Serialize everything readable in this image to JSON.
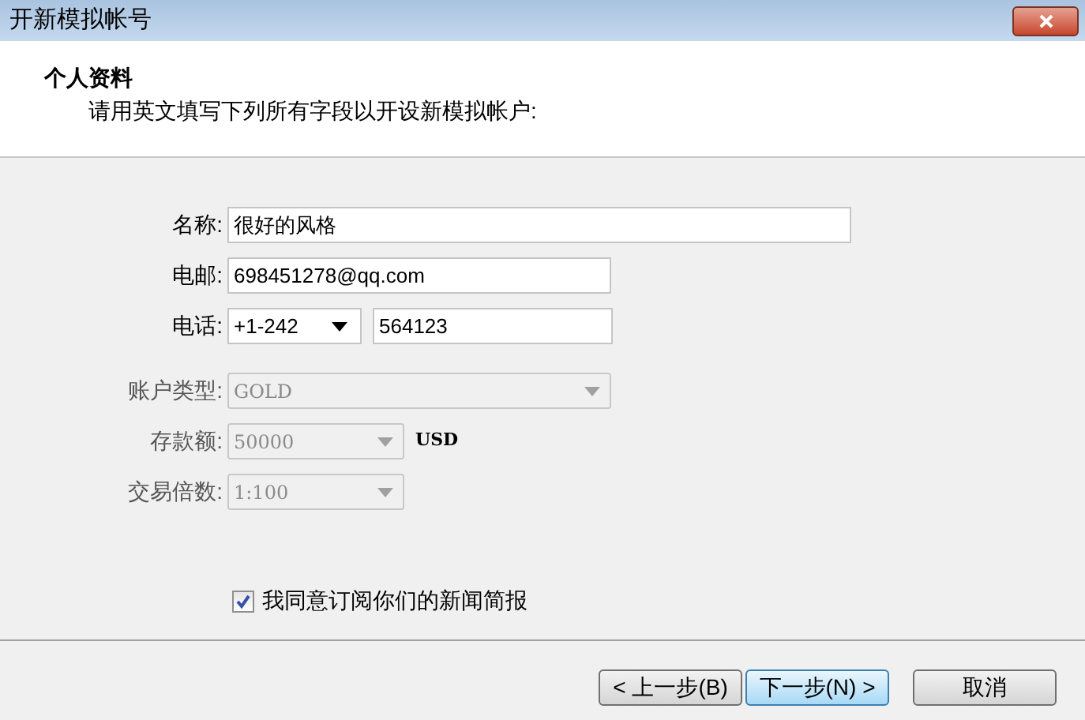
{
  "window": {
    "title": "开新模拟帐号"
  },
  "header": {
    "title": "个人资料",
    "subtitle": "请用英文填写下列所有字段以开设新模拟帐户:"
  },
  "fields": [
    {
      "kind": "text",
      "label": "名称:",
      "value": "很好的风格",
      "disabled": false
    },
    {
      "kind": "text",
      "label": "电邮:",
      "value": "698451278@qq.com",
      "disabled": false
    },
    {
      "kind": "phone",
      "label": "电话:",
      "code": "+1-242",
      "value": "564123",
      "disabled": false
    },
    {
      "kind": "select",
      "label": "账户类型:",
      "value": "GOLD",
      "disabled": true
    },
    {
      "kind": "select",
      "label": "存款额:",
      "value": "50000",
      "suffix": "USD",
      "disabled": true
    },
    {
      "kind": "select",
      "label": "交易倍数:",
      "value": "1:100",
      "disabled": true
    }
  ],
  "newsletter": {
    "label": "我同意订阅你们的新闻简报",
    "checked": true
  },
  "buttons": [
    {
      "kind": "back",
      "label": "< 上一步(B)",
      "focused": false
    },
    {
      "kind": "next",
      "label": "下一步(N) >",
      "focused": true
    },
    {
      "kind": "cancel",
      "label": "取消",
      "focused": false
    }
  ]
}
